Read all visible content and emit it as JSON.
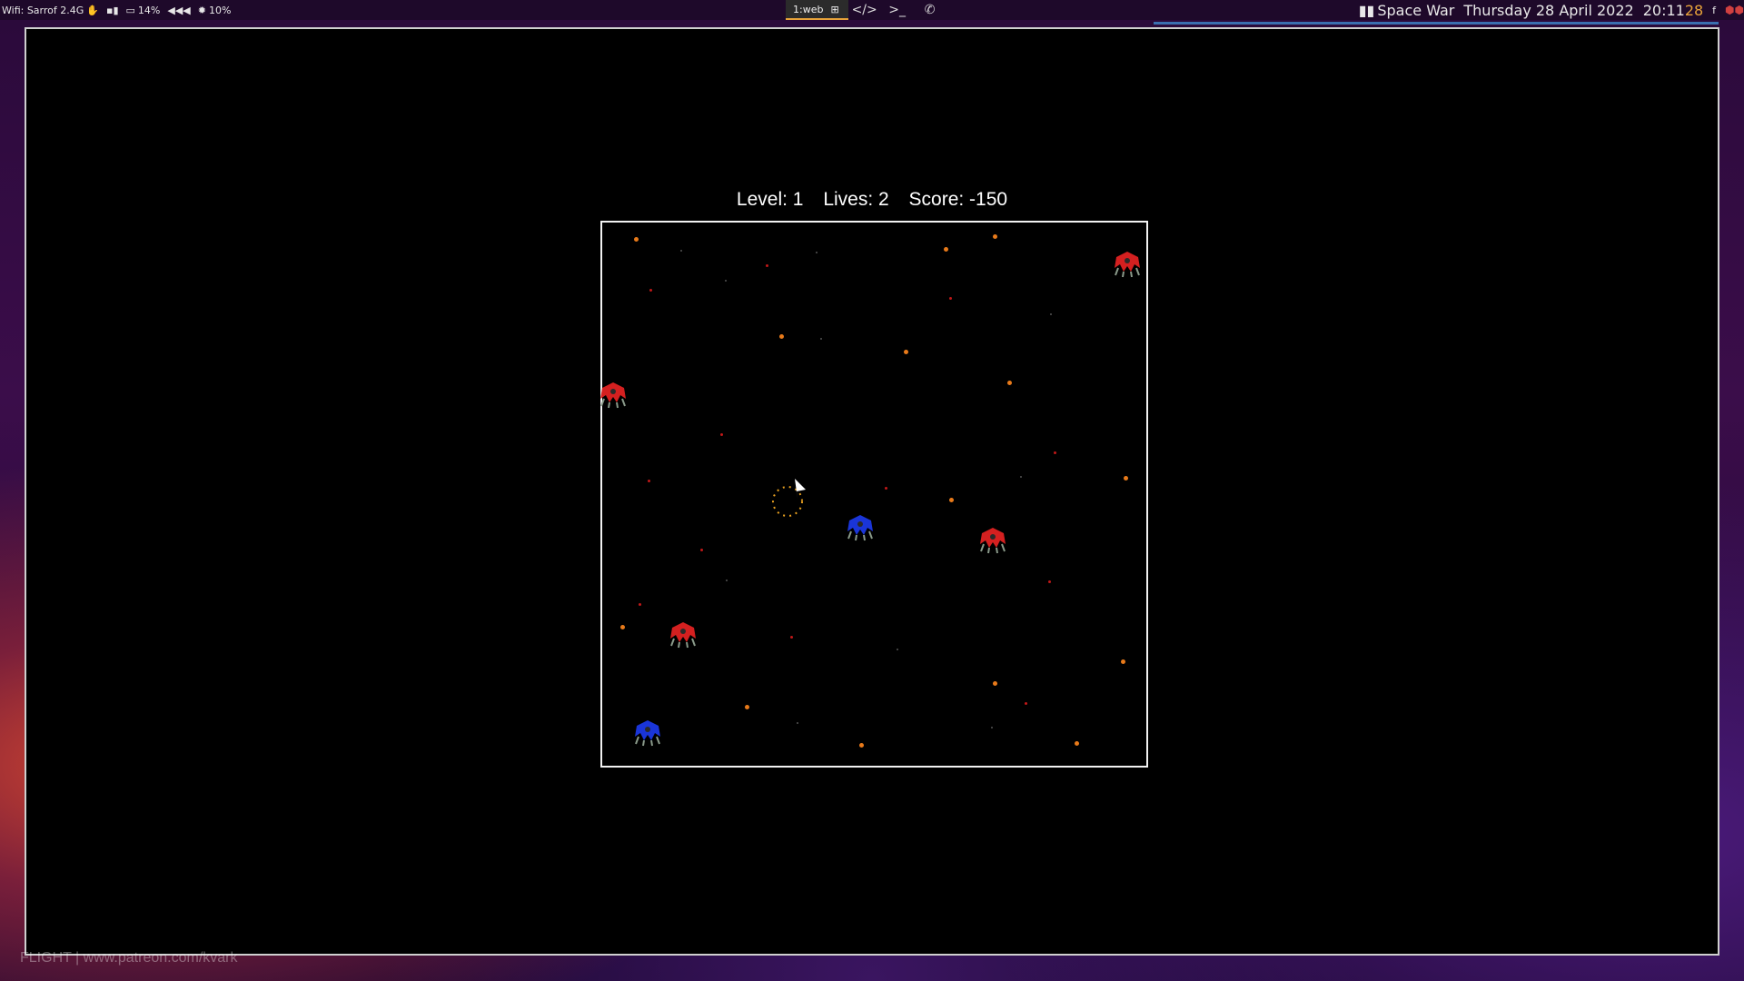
{
  "topbar": {
    "wifi": "Wifi: Sarrof 2.4G",
    "battery": "14%",
    "brightness": "10%",
    "workspace": "1:web",
    "app_title": "Space War",
    "date": "Thursday  28 April 2022",
    "time_hm": "20:11",
    "time_s": "28",
    "kb": "f"
  },
  "game": {
    "level_label": "Level: 1",
    "lives_label": "Lives: 2",
    "score_label": "Score: -150",
    "level": 1,
    "lives": 2,
    "score": -150
  },
  "colors": {
    "enemy": "#d42020",
    "ally": "#1a35d8",
    "particle_orange": "#e87a1a",
    "particle_red": "#c01818",
    "shield": "#e8a020"
  },
  "bottom_text": "FLIGHT | www.patreon.com/kvark"
}
